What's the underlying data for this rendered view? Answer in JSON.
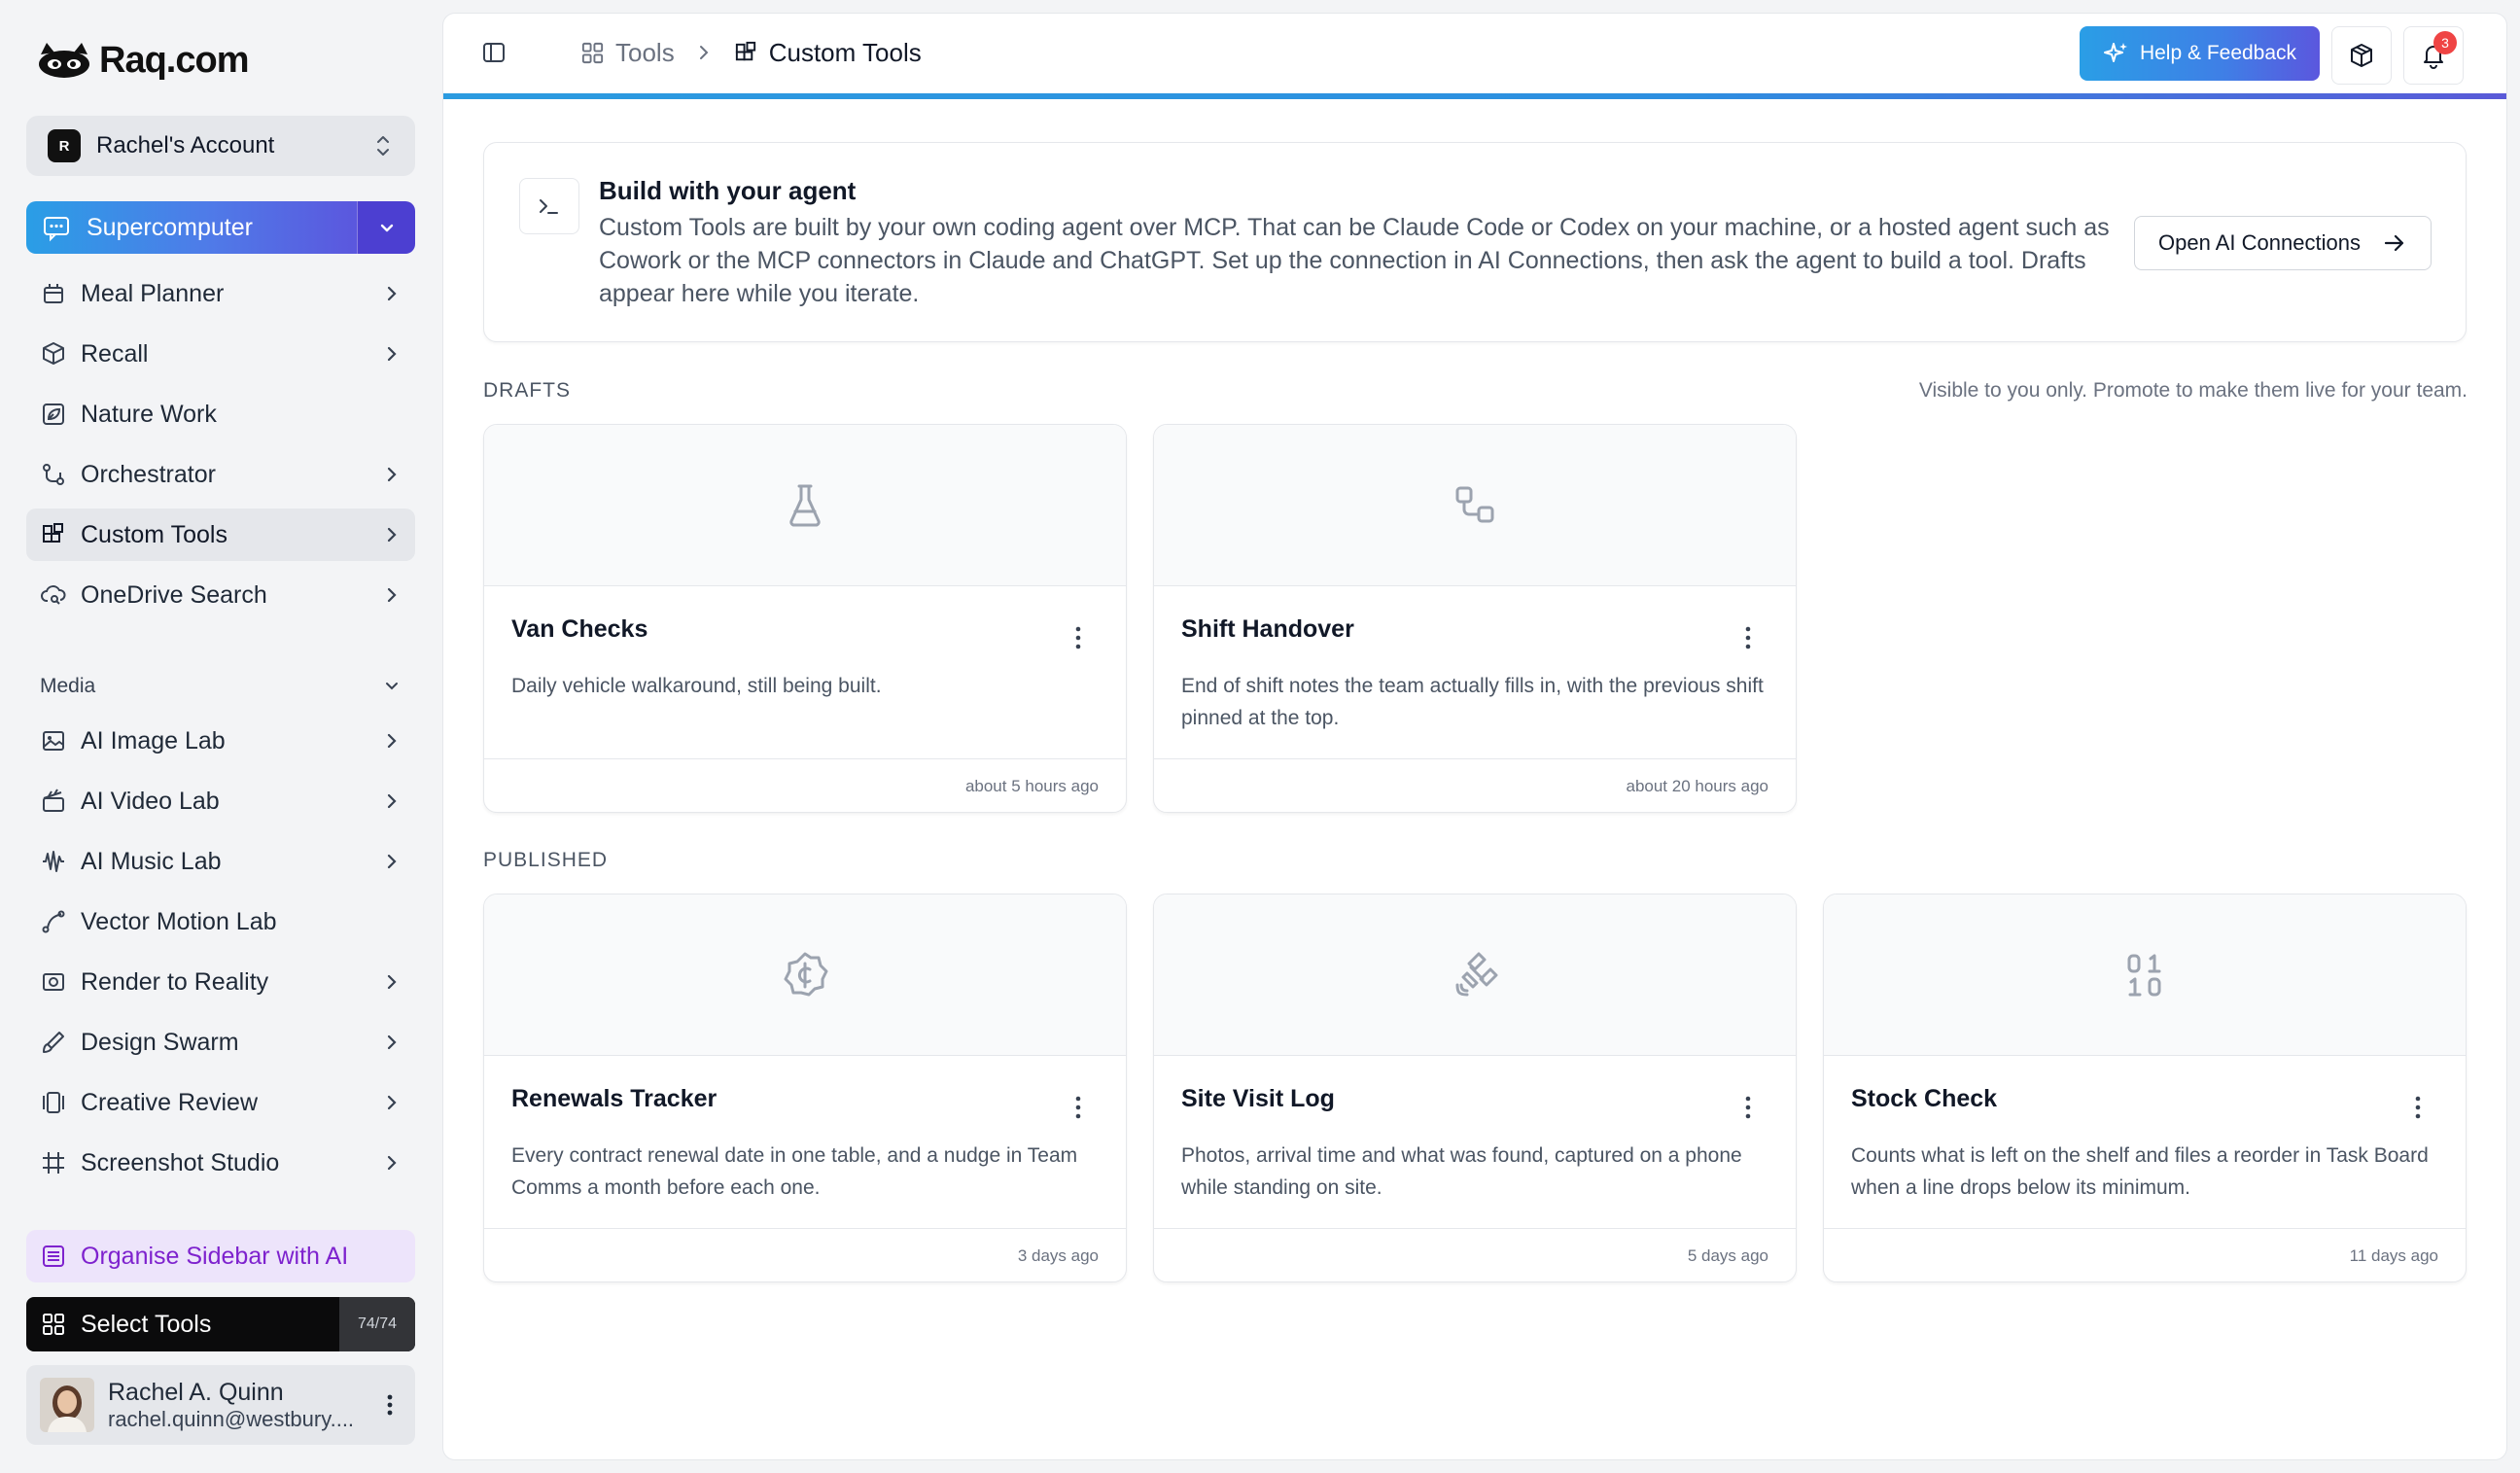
{
  "brand": {
    "name": "Raq.com"
  },
  "account": {
    "initial": "R",
    "name": "Rachel's Account"
  },
  "supercomputer": {
    "label": "Supercomputer"
  },
  "sidebar": {
    "items": [
      {
        "label": "Meal Planner",
        "icon": "calendar-pot-icon",
        "chevron": true
      },
      {
        "label": "Recall",
        "icon": "cube-search-icon",
        "chevron": true
      },
      {
        "label": "Nature Work",
        "icon": "leaf-icon",
        "chevron": false
      },
      {
        "label": "Orchestrator",
        "icon": "workflow-icon",
        "chevron": true
      },
      {
        "label": "Custom Tools",
        "icon": "blocks-icon",
        "chevron": true,
        "active": true
      },
      {
        "label": "OneDrive Search",
        "icon": "cloud-search-icon",
        "chevron": true
      }
    ],
    "media_heading": "Media",
    "media_items": [
      {
        "label": "AI Image Lab",
        "icon": "image-icon",
        "chevron": true
      },
      {
        "label": "AI Video Lab",
        "icon": "clapperboard-icon",
        "chevron": true
      },
      {
        "label": "AI Music Lab",
        "icon": "audio-wave-icon",
        "chevron": true
      },
      {
        "label": "Vector Motion Lab",
        "icon": "vector-pen-icon",
        "chevron": false
      },
      {
        "label": "Render to Reality",
        "icon": "render-icon",
        "chevron": true
      },
      {
        "label": "Design Swarm",
        "icon": "brush-icon",
        "chevron": true
      },
      {
        "label": "Creative Review",
        "icon": "gallery-icon",
        "chevron": true
      },
      {
        "label": "Screenshot Studio",
        "icon": "hash-frame-icon",
        "chevron": true
      }
    ],
    "organise_label": "Organise Sidebar with AI",
    "select_tools": {
      "label": "Select Tools",
      "count": "74/74"
    }
  },
  "user": {
    "name": "Rachel A. Quinn",
    "email": "rachel.quinn@westbury...."
  },
  "header": {
    "breadcrumbs": [
      "Tools",
      "Custom Tools"
    ],
    "help_label": "Help & Feedback",
    "notification_count": "3"
  },
  "agent_box": {
    "title": "Build with your agent",
    "text": "Custom Tools are built by your own coding agent over MCP. That can be Claude Code or Codex on your machine, or a hosted agent such as Cowork or the MCP connectors in Claude and ChatGPT. Set up the connection in AI Connections, then ask the agent to build a tool. Drafts appear here while you iterate.",
    "button_label": "Open AI Connections"
  },
  "drafts": {
    "heading": "DRAFTS",
    "note": "Visible to you only. Promote to make them live for your team.",
    "cards": [
      {
        "title": "Van Checks",
        "icon": "flask-icon",
        "desc": "Daily vehicle walkaround, still being built.",
        "time": "about 5 hours ago"
      },
      {
        "title": "Shift Handover",
        "icon": "squares-link-icon",
        "desc": "End of shift notes the team actually fills in, with the previous shift pinned at the top.",
        "time": "about 20 hours ago"
      }
    ]
  },
  "published": {
    "heading": "PUBLISHED",
    "cards": [
      {
        "title": "Renewals Tracker",
        "icon": "currency-badge-icon",
        "desc": "Every contract renewal date in one table, and a nudge in Team Comms a month before each one.",
        "time": "3 days ago"
      },
      {
        "title": "Site Visit Log",
        "icon": "satellite-icon",
        "desc": "Photos, arrival time and what was found, captured on a phone while standing on site.",
        "time": "5 days ago"
      },
      {
        "title": "Stock Check",
        "icon": "binary-icon",
        "desc": "Counts what is left on the shelf and files a reorder in Task Board when a line drops below its minimum.",
        "time": "11 days ago"
      }
    ]
  },
  "colors": {
    "accent_gradient_start": "#2a9ee6",
    "accent_gradient_end": "#5b57de",
    "organise_bg": "#ede4fb",
    "organise_text": "#7e22ce",
    "badge": "#ef4444"
  }
}
